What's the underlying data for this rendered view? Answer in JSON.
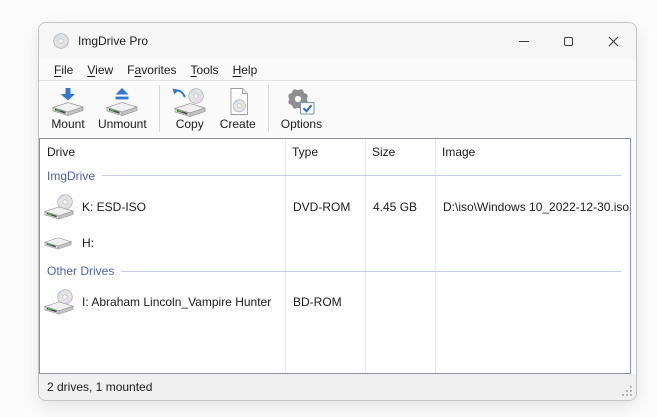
{
  "window": {
    "title": "ImgDrive Pro"
  },
  "menu": {
    "items": [
      {
        "label": "File",
        "pre": "",
        "key": "F",
        "post": "ile"
      },
      {
        "label": "View",
        "pre": "",
        "key": "V",
        "post": "iew"
      },
      {
        "label": "Favorites",
        "pre": "F",
        "key": "a",
        "post": "vorites"
      },
      {
        "label": "Tools",
        "pre": "",
        "key": "T",
        "post": "ools"
      },
      {
        "label": "Help",
        "pre": "",
        "key": "H",
        "post": "elp"
      }
    ]
  },
  "toolbar": {
    "items": [
      {
        "label": "Mount",
        "icon": "mount-drive-arrow-down-icon"
      },
      {
        "label": "Unmount",
        "icon": "unmount-drive-eject-icon"
      },
      {
        "label": "Copy",
        "icon": "copy-disc-arrow-icon"
      },
      {
        "label": "Create",
        "icon": "create-document-disc-icon"
      },
      {
        "label": "Options",
        "icon": "gear-checkbox-icon"
      }
    ]
  },
  "list": {
    "columns": [
      "Drive",
      "Type",
      "Size",
      "Image"
    ],
    "groups": [
      {
        "label": "ImgDrive",
        "rows": [
          {
            "name": "K: ESD-ISO",
            "type": "DVD-ROM",
            "size": "4.45 GB",
            "image": "D:\\iso\\Windows 10_2022-12-30.iso",
            "icon": "drive-with-disc-icon",
            "mounted": true
          },
          {
            "name": "H:",
            "type": "",
            "size": "",
            "image": "",
            "icon": "drive-icon",
            "mounted": false
          }
        ]
      },
      {
        "label": "Other Drives",
        "rows": [
          {
            "name": "I: Abraham Lincoln_Vampire Hunter",
            "type": "BD-ROM",
            "size": "",
            "image": "",
            "icon": "drive-with-disc-icon",
            "mounted": true
          }
        ]
      }
    ]
  },
  "statusbar": {
    "text": "2 drives, 1 mounted"
  },
  "colors": {
    "accent_blue": "#3079cf",
    "group_label_blue": "#4e5fb0",
    "led_green": "#5cb85c",
    "titlebar_bg": "#f6f6f6",
    "statusbar_bg": "#f0f0f0",
    "list_border": "#8a9099"
  }
}
